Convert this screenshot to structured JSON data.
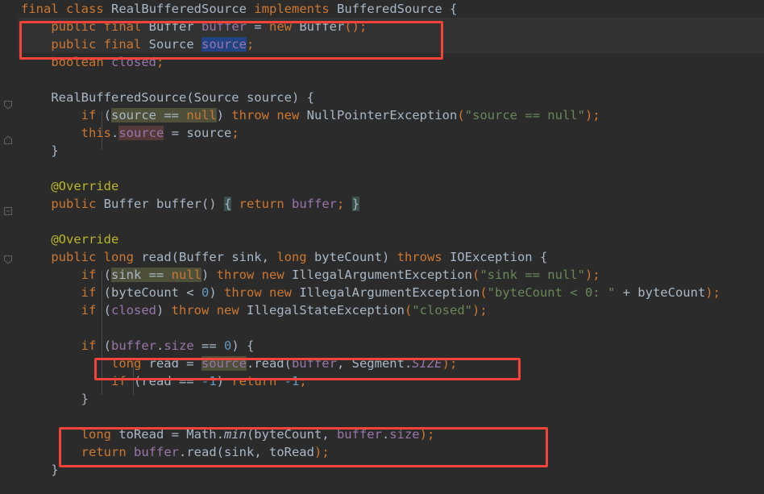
{
  "editor": {
    "language": "java",
    "theme": "darcula",
    "background": "#2b2b2b",
    "current_line_background": "#323232",
    "font_size_px": 15.5,
    "line_height_px": 22,
    "colors": {
      "keyword": "#cc7832",
      "identifier": "#a9b7c6",
      "field": "#9876aa",
      "string": "#6a8759",
      "number": "#6897bb",
      "annotation": "#bbb529",
      "selection": "#214283",
      "search_highlight": "#4f503a",
      "write_highlight": "#553a3a",
      "annotation_box": "#f4433a"
    }
  },
  "lines": [
    {
      "n": 1,
      "text": "final class RealBufferedSource implements BufferedSource {"
    },
    {
      "n": 2,
      "text": "    public final Buffer buffer = new Buffer();"
    },
    {
      "n": 3,
      "text": "    public final Source source;"
    },
    {
      "n": 4,
      "text": "    boolean closed;"
    },
    {
      "n": 5,
      "text": ""
    },
    {
      "n": 6,
      "text": "    RealBufferedSource(Source source) {"
    },
    {
      "n": 7,
      "text": "        if (source == null) throw new NullPointerException(\"source == null\");"
    },
    {
      "n": 8,
      "text": "        this.source = source;"
    },
    {
      "n": 9,
      "text": "    }"
    },
    {
      "n": 10,
      "text": ""
    },
    {
      "n": 11,
      "text": "    @Override"
    },
    {
      "n": 12,
      "text": "    public Buffer buffer() { return buffer; }"
    },
    {
      "n": 13,
      "text": ""
    },
    {
      "n": 14,
      "text": "    @Override"
    },
    {
      "n": 15,
      "text": "    public long read(Buffer sink, long byteCount) throws IOException {"
    },
    {
      "n": 16,
      "text": "        if (sink == null) throw new IllegalArgumentException(\"sink == null\");"
    },
    {
      "n": 17,
      "text": "        if (byteCount < 0) throw new IllegalArgumentException(\"byteCount < 0: \" + byteCount);"
    },
    {
      "n": 18,
      "text": "        if (closed) throw new IllegalStateException(\"closed\");"
    },
    {
      "n": 19,
      "text": ""
    },
    {
      "n": 20,
      "text": "        if (buffer.size == 0) {"
    },
    {
      "n": 21,
      "text": "            long read = source.read(buffer, Segment.SIZE);"
    },
    {
      "n": 22,
      "text": "            if (read == -1) return -1;"
    },
    {
      "n": 23,
      "text": "        }"
    },
    {
      "n": 24,
      "text": ""
    },
    {
      "n": 25,
      "text": "        long toRead = Math.min(byteCount, buffer.size);"
    },
    {
      "n": 26,
      "text": "        return buffer.read(sink, toRead);"
    },
    {
      "n": 27,
      "text": "    }"
    }
  ],
  "selection": {
    "line": 3,
    "token": "source"
  },
  "highlighted_occurrences": [
    {
      "line": 3,
      "token": "source",
      "kind": "selection"
    },
    {
      "line": 7,
      "token": "source == null",
      "kind": "search"
    },
    {
      "line": 8,
      "token": "source",
      "kind": "write"
    },
    {
      "line": 12,
      "token": "{",
      "kind": "brace"
    },
    {
      "line": 12,
      "token": "}",
      "kind": "brace"
    },
    {
      "line": 16,
      "token": "sink == null",
      "kind": "search"
    },
    {
      "line": 21,
      "token": "source",
      "kind": "search"
    }
  ],
  "annotation_boxes": [
    {
      "id": "box-fields",
      "label": "public final Buffer buffer / public final Source source",
      "lines": [
        2,
        3
      ]
    },
    {
      "id": "box-refill",
      "label": "long read = source.read(buffer, Segment.SIZE);",
      "lines": [
        21
      ]
    },
    {
      "id": "box-return",
      "label": "long toRead = Math.min(byteCount, buffer.size); / return buffer.read(sink, toRead);",
      "lines": [
        25,
        26
      ]
    }
  ],
  "gutter": {
    "fold_markers": [
      {
        "line": 6,
        "state": "expanded"
      },
      {
        "line": 9,
        "state": "collapsed-end"
      },
      {
        "line": 12,
        "state": "folded"
      },
      {
        "line": 15,
        "state": "expanded"
      }
    ]
  }
}
